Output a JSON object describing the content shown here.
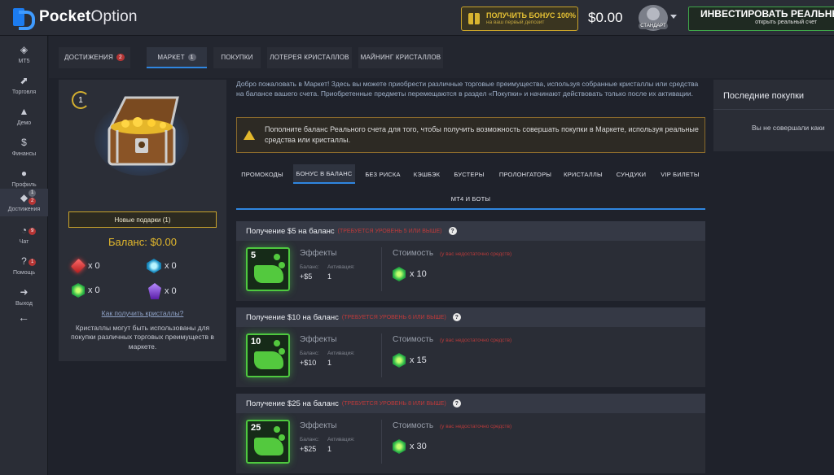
{
  "app": {
    "logo_bold": "Pocket",
    "logo_light": "Option",
    "bonus_main": "ПОЛУЧИТЬ БОНУС 100%",
    "bonus_sub": "на ваш первый депозит",
    "balance": "$0.00",
    "avatar_badge": "СТАНДАРТ",
    "invest_main": "ИНВЕСТИРОВАТЬ РЕАЛЬНЫЕ",
    "invest_sub": "открыть реальный счет"
  },
  "sidebar": {
    "items": [
      {
        "label": "MT5",
        "icon": "◈"
      },
      {
        "label": "Торговля",
        "icon": "⬈"
      },
      {
        "label": "Демо",
        "icon": "▲"
      },
      {
        "label": "Финансы",
        "icon": "$"
      },
      {
        "label": "Профиль",
        "icon": "●"
      },
      {
        "label": "Достижения",
        "icon": "◆"
      },
      {
        "label": "Чат",
        "icon": "◔"
      },
      {
        "label": "Помощь",
        "icon": "?"
      },
      {
        "label": "Выход",
        "icon": "➜"
      }
    ],
    "badges": {
      "achievements_top": "1",
      "achievements_bottom": "2",
      "chat": "9",
      "help": "1"
    },
    "back_icon": "←"
  },
  "tabs": [
    {
      "label": "ДОСТИЖЕНИЯ",
      "badge": "2"
    },
    {
      "label": "МАРКЕТ",
      "badge": "1"
    },
    {
      "label": "ПОКУПКИ"
    },
    {
      "label": "ЛОТЕРЕЯ КРИСТАЛЛОВ"
    },
    {
      "label": "МАЙНИНГ КРИСТАЛЛОВ"
    }
  ],
  "left_panel": {
    "level": "1",
    "gifts_button": "Новые подарки (1)",
    "balance": "Баланс: $0.00",
    "crystals": [
      "x 0",
      "x 0",
      "x 0",
      "x 0"
    ],
    "how_link": "Как получить кристаллы?",
    "description": "Кристаллы могут быть использованы для покупки различных торговых преимуществ в маркете."
  },
  "intro_text": "Добро пожаловать в Маркет! Здесь вы можете приобрести различные торговые преимущества, используя собранные кристаллы или средства на балансе вашего счета. Приобретенные предметы перемещаются в раздел «Покупки» и начинают действовать только после их активации.",
  "warning_text": "Пополните баланс Реального счета для того, чтобы получить возможность совершать покупки в Маркете, используя реальные средства или кристаллы.",
  "categories": [
    "ПРОМОКОДЫ",
    "БОНУС В БАЛАНС",
    "БЕЗ РИСКА",
    "КЭШБЭК",
    "БУСТЕРЫ",
    "ПРОЛОНГАТОРЫ",
    "КРИСТАЛЛЫ",
    "СУНДУКИ",
    "VIP БИЛЕТЫ",
    "МТ4 И БОТЫ"
  ],
  "offer_labels": {
    "effects": "Эффекты",
    "balance": "Баланс:",
    "activation": "Активация:",
    "cost": "Стоимость",
    "cost_note": "(у вас недостаточно средств)",
    "help": "?"
  },
  "offers": [
    {
      "title": "Получение $5 на баланс",
      "requirement": "(ТРЕБУЕТСЯ УРОВЕНЬ 5 ИЛИ ВЫШЕ)",
      "img_num": "5",
      "balance_val": "+$5",
      "activation_val": "1",
      "cost": "x 10"
    },
    {
      "title": "Получение $10 на баланс",
      "requirement": "(ТРЕБУЕТСЯ УРОВЕНЬ 6 ИЛИ ВЫШЕ)",
      "img_num": "10",
      "balance_val": "+$10",
      "activation_val": "1",
      "cost": "x 15"
    },
    {
      "title": "Получение $25 на баланс",
      "requirement": "(ТРЕБУЕТСЯ УРОВЕНЬ 8 ИЛИ ВЫШЕ)",
      "img_num": "25",
      "balance_val": "+$25",
      "activation_val": "1",
      "cost": "x 30"
    }
  ],
  "right_panel": {
    "title": "Последние покупки",
    "empty": "Вы не совершали каки"
  }
}
